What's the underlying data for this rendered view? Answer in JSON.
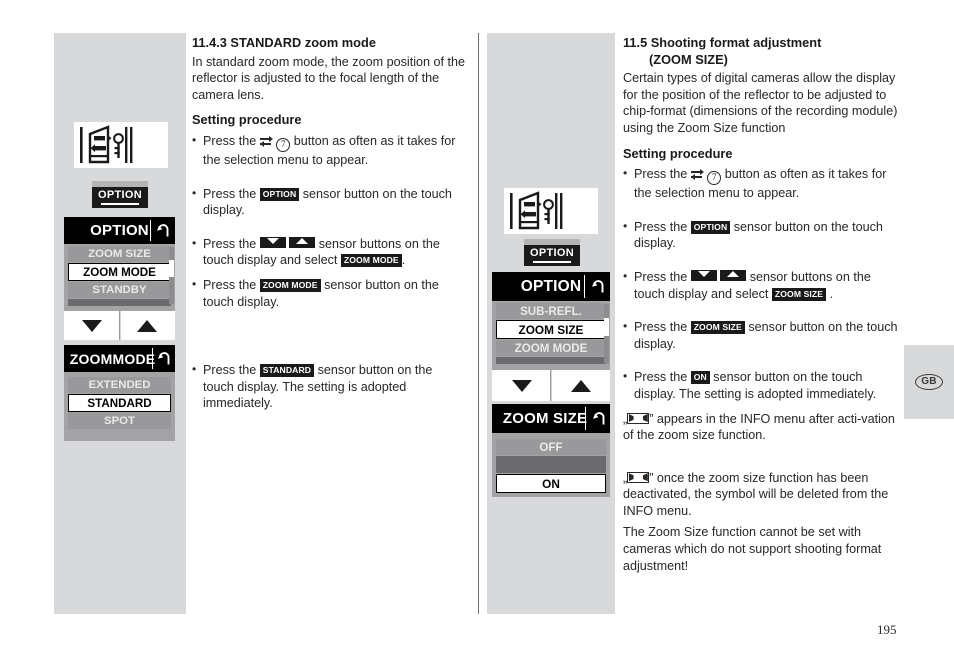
{
  "page": {
    "number": "195",
    "country_tab": "GB"
  },
  "left_column": {
    "pictogram_name": "flash-reflector-zoom-diagram",
    "option_button": {
      "label": "OPTION"
    },
    "menu_option": {
      "title": "OPTION",
      "back_icon": "back-arrow-icon",
      "rows": [
        {
          "label": "ZOOM SIZE",
          "state": "dim"
        },
        {
          "label": "ZOOM MODE",
          "state": "selected"
        },
        {
          "label": "STANDBY",
          "state": "dim"
        },
        {
          "label": "",
          "state": "blank"
        }
      ],
      "nav": {
        "down": "down-arrow-button",
        "up": "up-arrow-button"
      }
    },
    "menu_zoommode": {
      "title": "ZOOMMODE",
      "back_icon": "back-arrow-icon",
      "rows": [
        {
          "label": "EXTENDED",
          "state": "dim"
        },
        {
          "label": "STANDARD",
          "state": "selected"
        },
        {
          "label": "SPOT",
          "state": "dim"
        }
      ]
    }
  },
  "middle_column": {
    "pictogram_name": "flash-reflector-zoom-diagram",
    "option_button": {
      "label": "OPTION"
    },
    "menu_option": {
      "title": "OPTION",
      "back_icon": "back-arrow-icon",
      "rows": [
        {
          "label": "SUB-REFL.",
          "state": "dim"
        },
        {
          "label": "ZOOM SIZE",
          "state": "selected"
        },
        {
          "label": "ZOOM MODE",
          "state": "dim"
        },
        {
          "label": "",
          "state": "blank"
        }
      ],
      "nav": {
        "down": "down-arrow-button",
        "up": "up-arrow-button"
      }
    },
    "menu_zoomsize": {
      "title": "ZOOM SIZE",
      "back_icon": "back-arrow-icon",
      "rows": [
        {
          "label": "OFF",
          "state": "dim"
        },
        {
          "label": "ON",
          "state": "selected"
        }
      ]
    }
  },
  "section_left": {
    "heading": "11.4.3 STANDARD zoom mode",
    "intro": "In standard zoom mode, the zoom position of the reflector is adjusted to the focal length of the camera lens.",
    "procedure_heading": "Setting procedure",
    "steps": [
      {
        "pre": "Press the",
        "icon": "swap-arrows-icon",
        "ref": "7",
        "post": "button as often as it takes for the selection menu to appear."
      },
      {
        "pre": "Press the",
        "chip": "OPTION",
        "post": "sensor button on the touch display."
      },
      {
        "pre": "Press the",
        "arrows": [
          "down",
          "up"
        ],
        "mid": "sensor buttons on the touch display and select",
        "chip": "ZOOM MODE",
        "post": "."
      },
      {
        "pre": "Press the",
        "chip": "ZOOM MODE",
        "post": "sensor button on the touch display."
      },
      {
        "pre": "Press the",
        "chip": "STANDARD",
        "post": "sensor button on the touch display.",
        "extra": "The setting is adopted immediately."
      }
    ]
  },
  "section_right": {
    "heading_line1": "11.5 Shooting format adjustment",
    "heading_line2": "(ZOOM SIZE)",
    "intro": "Certain types of digital cameras allow the display for the position of the reflector to be adjusted to chip-format (dimensions of the recording module) using the Zoom Size function",
    "procedure_heading": "Setting procedure",
    "steps": [
      {
        "pre": "Press the",
        "icon": "swap-arrows-icon",
        "ref": "7",
        "post": "button as often as it takes for the selection menu to appear."
      },
      {
        "pre": "Press the",
        "chip": "OPTION",
        "post": "sensor button on the touch display."
      },
      {
        "pre": "Press the",
        "arrows": [
          "down",
          "up"
        ],
        "mid": "sensor buttons on the touch display and select",
        "chip": "ZOOM SIZE",
        "post": "."
      },
      {
        "pre": "Press the",
        "chip": "ZOOM SIZE",
        "post": "sensor button on the touch display."
      },
      {
        "pre": "Press the",
        "chip": "ON",
        "post": "sensor button on the touch display. The setting is adopted immediately."
      }
    ],
    "notes": [
      {
        "open_quote": "„",
        "symbol": "zoom-size-symbol",
        "close_quote": "”",
        "text": " appears in the INFO menu after acti-vation of the zoom size function."
      },
      {
        "open_quote": "„",
        "symbol": "zoom-size-symbol",
        "close_quote": "”",
        "text": " once the zoom size function has been deactivated, the symbol will be deleted from the INFO menu."
      }
    ],
    "warning": "The Zoom Size function cannot be set with cameras which do not support shooting format adjustment!"
  }
}
